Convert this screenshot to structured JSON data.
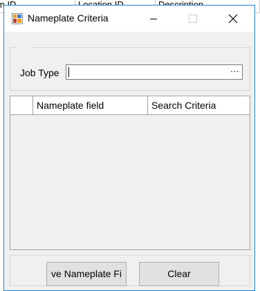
{
  "background_grid": {
    "columns": [
      "m ID",
      "Location ID",
      "Description"
    ]
  },
  "window": {
    "title": "Nameplate Criteria",
    "icon": "app-form-icon",
    "controls": {
      "minimize_icon": "minimize-icon",
      "maximize_icon": "maximize-icon",
      "close_icon": "close-icon"
    }
  },
  "filter": {
    "job_type_label": "Job Type",
    "job_type_value": "",
    "browse_button_label": "···"
  },
  "criteria_grid": {
    "columns": [
      "",
      "Nameplate field",
      "Search Criteria"
    ],
    "rows": []
  },
  "actions": {
    "save_label": "ve Nameplate Fi",
    "clear_label": "Clear"
  },
  "colors": {
    "window_border": "#1883d7",
    "dialog_bg": "#f0f0f0",
    "button_bg": "#e1e1e1"
  }
}
